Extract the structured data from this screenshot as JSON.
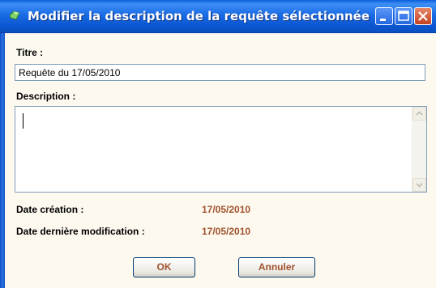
{
  "window": {
    "title": "Modifier la description de la requête sélectionnée",
    "icon": "gem-icon"
  },
  "titre": {
    "label": "Titre :",
    "value": "Requête du 17/05/2010"
  },
  "description": {
    "label": "Description :",
    "value": ""
  },
  "date_creation": {
    "label": "Date création :",
    "value": "17/05/2010"
  },
  "date_modification": {
    "label": "Date dernière modification :",
    "value": "17/05/2010"
  },
  "buttons": {
    "ok": "OK",
    "cancel": "Annuler"
  },
  "colors": {
    "titlebar": "#0a5fd8",
    "accent_value": "#a0522d",
    "background": "#fdf9ef"
  }
}
